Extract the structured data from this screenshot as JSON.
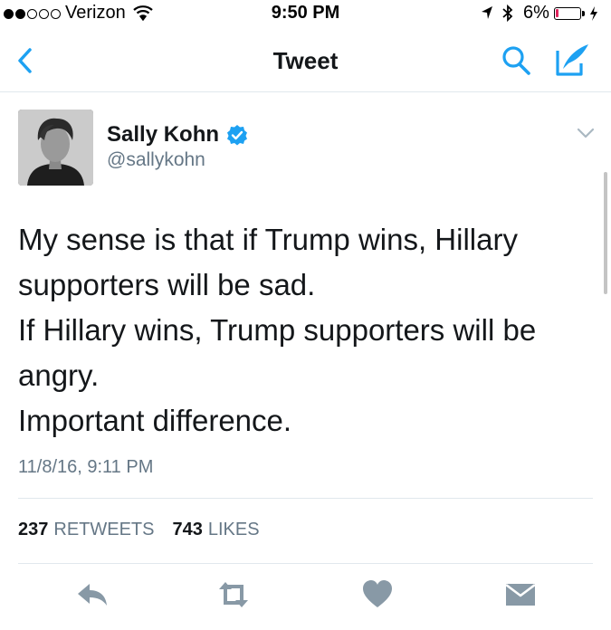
{
  "status_bar": {
    "carrier": "Verizon",
    "time": "9:50 PM",
    "battery_percent": "6%",
    "signal_bars": 2,
    "signal_total": 5
  },
  "nav": {
    "title": "Tweet",
    "back_icon": "chevron-left-icon",
    "search_icon": "search-icon",
    "compose_icon": "compose-tweet-icon"
  },
  "tweet": {
    "author_name": "Sally Kohn",
    "author_handle": "@sallykohn",
    "text_lines": [
      "My sense is that if Trump wins, Hillary",
      "supporters will be sad.",
      "If Hillary wins, Trump supporters will be",
      "angry.",
      "Important difference."
    ],
    "timestamp": "11/8/16, 9:11 PM",
    "retweet_count": "237",
    "retweet_label": "RETWEETS",
    "like_count": "743",
    "like_label": "LIKES"
  },
  "actions": {
    "reply_icon": "reply-icon",
    "retweet_icon": "retweet-icon",
    "like_icon": "heart-icon",
    "message_icon": "direct-message-icon"
  },
  "colors": {
    "accent": "#1da1f2",
    "text": "#14171a",
    "secondary": "#657786",
    "icon_gray": "#8899a6",
    "battery_low": "#e0245e"
  }
}
